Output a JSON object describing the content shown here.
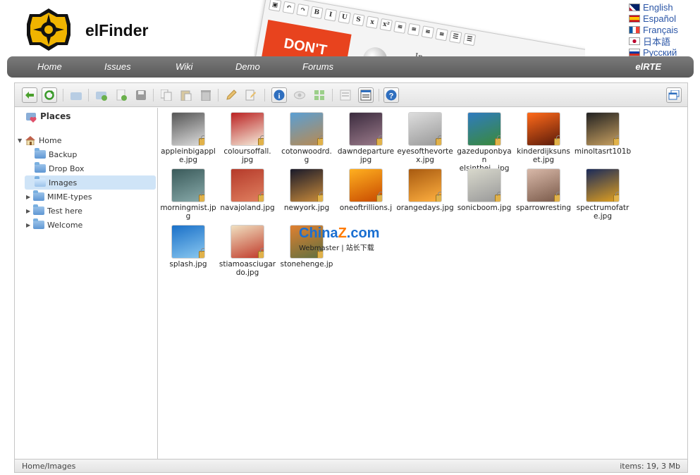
{
  "brand": {
    "name": "elFinder"
  },
  "promo": {
    "headline": "DON'T",
    "snippet": "In"
  },
  "languages": [
    {
      "label": "English",
      "flag": "uk"
    },
    {
      "label": "Español",
      "flag": "es"
    },
    {
      "label": "Français",
      "flag": "fr"
    },
    {
      "label": "日本語",
      "flag": "jp"
    },
    {
      "label": "Русский",
      "flag": "ru"
    }
  ],
  "nav": {
    "items": [
      "Home",
      "Issues",
      "Wiki",
      "Demo",
      "Forums"
    ],
    "right": "elRTE"
  },
  "toolbar": {
    "buttons": [
      "back-icon",
      "reload-icon",
      "open-icon",
      "new-folder-icon",
      "new-file-icon",
      "upload-icon",
      "copy-icon",
      "paste-icon",
      "remove-icon",
      "rename-icon",
      "edit-icon",
      "info-icon",
      "preview-icon",
      "icons-view-icon",
      "list-view-icon",
      "details-icon",
      "help-icon",
      "fullscreen-icon"
    ]
  },
  "sidebar": {
    "places": "Places",
    "tree": [
      {
        "label": "Home",
        "expanded": true
      },
      {
        "label": "Backup"
      },
      {
        "label": "Drop Box"
      },
      {
        "label": "Images",
        "selected": true
      },
      {
        "label": "MIME-types",
        "collapsed": true
      },
      {
        "label": "Test here",
        "collapsed": true
      },
      {
        "label": "Welcome",
        "collapsed": true
      }
    ]
  },
  "files": [
    {
      "name": "appleinbigapple.jpg",
      "line1": "appleinbigappl",
      "line2": "e.jpg",
      "colors": [
        "#555",
        "#ddd"
      ]
    },
    {
      "name": "coloursoffall.jpg",
      "line1": "coloursoffall.",
      "line2": "jpg",
      "colors": [
        "#b22",
        "#f5eedd"
      ]
    },
    {
      "name": "cotonwoodrd.jpg",
      "line1": "cotonwoodrd.",
      "line2": "g",
      "colors": [
        "#5a9fd4",
        "#b88a52"
      ]
    },
    {
      "name": "dawndeparture.jpg",
      "line1": "dawndeparture",
      "line2": "jpg",
      "colors": [
        "#3b2b3e",
        "#9a7a8a"
      ]
    },
    {
      "name": "eyesofthevortex.jpg",
      "line1": "eyesofthevorte",
      "line2": "x.jpg",
      "colors": [
        "#ddd",
        "#999"
      ]
    },
    {
      "name": "gazeduponbyangelsintheir.jpg",
      "line1": "gazeduponbyan",
      "line2": "elsinthei...jpg",
      "colors": [
        "#2f7bbf",
        "#3a8a3a"
      ]
    },
    {
      "name": "kinderdijksunset.jpg",
      "line1": "kinderdijksuns",
      "line2": "et.jpg",
      "colors": [
        "#ff6a1a",
        "#5a1a0a"
      ]
    },
    {
      "name": "minoltasrt101b.jpg",
      "line1": "minoltasrt101b",
      "line2": "",
      "colors": [
        "#222",
        "#c8a060"
      ]
    },
    {
      "name": "morningmist.jpg",
      "line1": "morningmist.jp",
      "line2": "g",
      "colors": [
        "#3a5a5a",
        "#8aa"
      ]
    },
    {
      "name": "navajoland.jpg",
      "line1": "navajoland.jpg",
      "line2": "",
      "colors": [
        "#b53a2a",
        "#e08060"
      ]
    },
    {
      "name": "newyork.jpg",
      "line1": "newyork.jpg",
      "line2": "",
      "colors": [
        "#1a1a2a",
        "#c88a3a"
      ]
    },
    {
      "name": "oneoftrillions.jpg",
      "line1": "oneoftrillions.j",
      "line2": "",
      "colors": [
        "#ffb020",
        "#c84a00"
      ]
    },
    {
      "name": "orangedays.jpg",
      "line1": "orangedays.jpg",
      "line2": "",
      "colors": [
        "#a85a10",
        "#ffb040"
      ]
    },
    {
      "name": "sonicboom.jpg",
      "line1": "sonicboom.jpg",
      "line2": "",
      "colors": [
        "#d8d8cc",
        "#999"
      ]
    },
    {
      "name": "sparrowresting.jpg",
      "line1": "sparrowresting",
      "line2": "",
      "colors": [
        "#d8b8a8",
        "#7a5a4a"
      ]
    },
    {
      "name": "spectrumofatre.jpg",
      "line1": "spectrumofatr",
      "line2": "e.jpg",
      "colors": [
        "#1a2a5a",
        "#e0a020"
      ]
    },
    {
      "name": "splash.jpg",
      "line1": "splash.jpg",
      "line2": "",
      "colors": [
        "#1a70c8",
        "#8ac8f0"
      ]
    },
    {
      "name": "stiamoasciugando.jpg",
      "line1": "stiamoasciugar",
      "line2": "do.jpg",
      "colors": [
        "#f0e0c0",
        "#c03a2a"
      ]
    },
    {
      "name": "stonehenge.jpg",
      "line1": "stonehenge.jp",
      "line2": "",
      "colors": [
        "#e08030",
        "#607040"
      ]
    }
  ],
  "status": {
    "path": "Home/Images",
    "stats": "items: 19, 3 Mb"
  },
  "watermark": {
    "logo_main": "China",
    "logo_z": "Z",
    "logo_tail": ".com",
    "sub": "Webmaster | 站长下载"
  }
}
